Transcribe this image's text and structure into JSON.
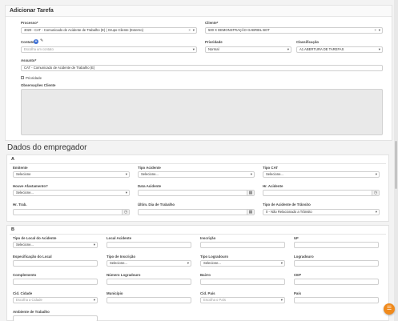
{
  "task": {
    "title": "Adicionar Tarefa",
    "processo_label": "Processo*",
    "processo_value": "3020 - CAT - Comunicado de Acidente de Trabalho (E) | Grupo Cliente (Externo)",
    "cliente_label": "Cliente*",
    "cliente_value": "500 X DEMONSTRAÇÃO GABRIEL BOT",
    "contato_label": "Contato",
    "contato_placeholder": "Escolha um contato",
    "prioridade_label": "Prioridade",
    "prioridade_value": "Normal",
    "classificacao_label": "Classificação",
    "classificacao_value": "A1 ABERTURA DE TAREFAS",
    "assunto_label": "Assunto*",
    "assunto_value": "CAT - Comunicado de Acidente de Trabalho (E)",
    "prioridade_check_label": "Prioridade",
    "observacoes_label": "Observações Cliente"
  },
  "section": {
    "title": "Dados do empregador"
  },
  "card_a": {
    "letter": "A",
    "emitente_label": "Emitente",
    "emitente_value": "Selecione",
    "tipo_acidente_label": "Tipo Acidente",
    "tipo_acidente_value": "Selecione...",
    "tipo_cat_label": "Tipo CAT",
    "tipo_cat_value": "Selecione...",
    "houve_afastamento_label": "Houve Afastamento?",
    "houve_afastamento_value": "Selecione...",
    "data_acidente_label": "Data Acidente",
    "hr_acidente_label": "Hr. Acidente",
    "hr_trab_label": "Hr. Trab.",
    "ultim_dia_label": "Últim. Dia de Trabalho",
    "tipo_acidente_transito_label": "Tipo de Acidente de Trânsito",
    "tipo_acidente_transito_value": "0 - Não Relacionado a Trânsito"
  },
  "card_b": {
    "letter": "B",
    "tipo_local_label": "Tipo de Local do Acidente",
    "tipo_local_value": "Selecione...",
    "local_acidente_label": "Local Acidente",
    "inscricao_label": "Inscrição",
    "uf_label": "UF",
    "especificacao_label": "Especificação do Local",
    "tipo_inscricao_label": "Tipo de Inscrição",
    "tipo_inscricao_value": "Selecione...",
    "tipo_logradouro_label": "Tipo Logradouro",
    "tipo_logradouro_value": "Selecione...",
    "logradouro_label": "Logradouro",
    "complemento_label": "Complemento",
    "numero_logradouro_label": "Número Logradouro",
    "bairro_label": "Bairro",
    "cep_label": "CEP",
    "cid_cidade_label": "Cid. Cidade",
    "cid_cidade_value": "Escolha a Cidade",
    "municipio_label": "Município",
    "cid_pais_label": "Cid. País",
    "cid_pais_value": "Escolha o País",
    "pais_label": "País",
    "ambiente_label": "Ambiente de Trabalho"
  },
  "icons": {
    "caret": "▾",
    "clear": "×",
    "calendar": "▦",
    "clock": "◷",
    "plus": "+",
    "pencil": "✎",
    "fab": "☰"
  },
  "colors": {
    "accent": "#3d6fd6",
    "fab": "#f08a1c"
  }
}
